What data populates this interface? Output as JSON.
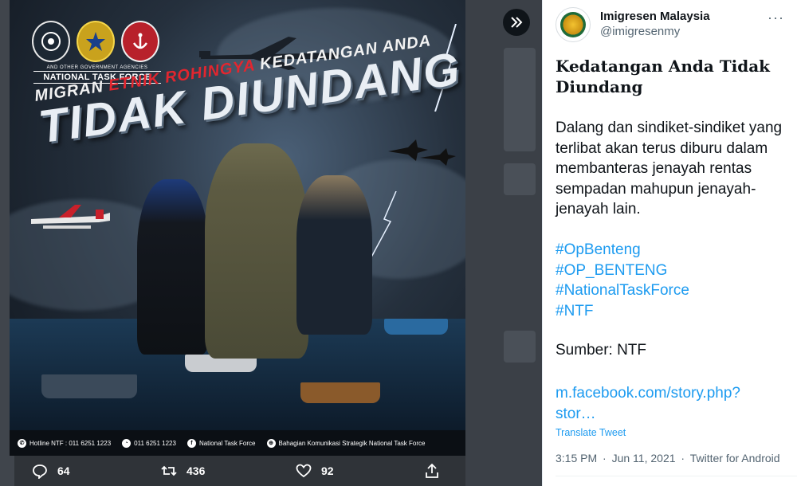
{
  "poster": {
    "agency_caption_small": "AND OTHER GOVERNMENT AGENCIES",
    "agency_caption": "NATIONAL TASK FORCE",
    "headline_prefix": "MIGRAN",
    "headline_red": "ETNIK ROHINGYA",
    "headline_suffix": "KEDATANGAN ANDA",
    "headline_main": "TIDAK DIUNDANG",
    "footer": [
      {
        "icon": "phone-icon",
        "glyph": "✆",
        "text": "Hotline NTF : 011 6251 1223"
      },
      {
        "icon": "whatsapp-icon",
        "glyph": "◔",
        "text": "011 6251 1223"
      },
      {
        "icon": "facebook-icon",
        "glyph": "f",
        "text": "National Task Force"
      },
      {
        "icon": "globe-icon",
        "glyph": "⊕",
        "text": "Bahagian Komunikasi Strategik National Task Force"
      }
    ]
  },
  "actions": {
    "reply_count": "64",
    "retweet_count": "436",
    "like_count": "92"
  },
  "tweet": {
    "author_name": "Imigresen Malaysia",
    "author_handle": "@imigresenmy",
    "title": "Kedatangan Anda Tidak Diundang",
    "body": "Dalang dan sindiket-sindiket yang terlibat akan terus diburu dalam membanteras jenayah rentas sempadan mahupun jenayah-jenayah lain.",
    "hashtags": [
      "#OpBenteng",
      "#OP_BENTENG",
      "#NationalTaskForce",
      "#NTF"
    ],
    "source": "Sumber: NTF",
    "link": "m.facebook.com/story.php?stor…",
    "translate": "Translate Tweet",
    "time": "3:15 PM",
    "date": "Jun 11, 2021",
    "client": "Twitter for Android",
    "separator": "·"
  },
  "colors": {
    "link_blue": "#1d9bf0",
    "headline_red": "#e2262f",
    "secondary_text": "#536471"
  }
}
